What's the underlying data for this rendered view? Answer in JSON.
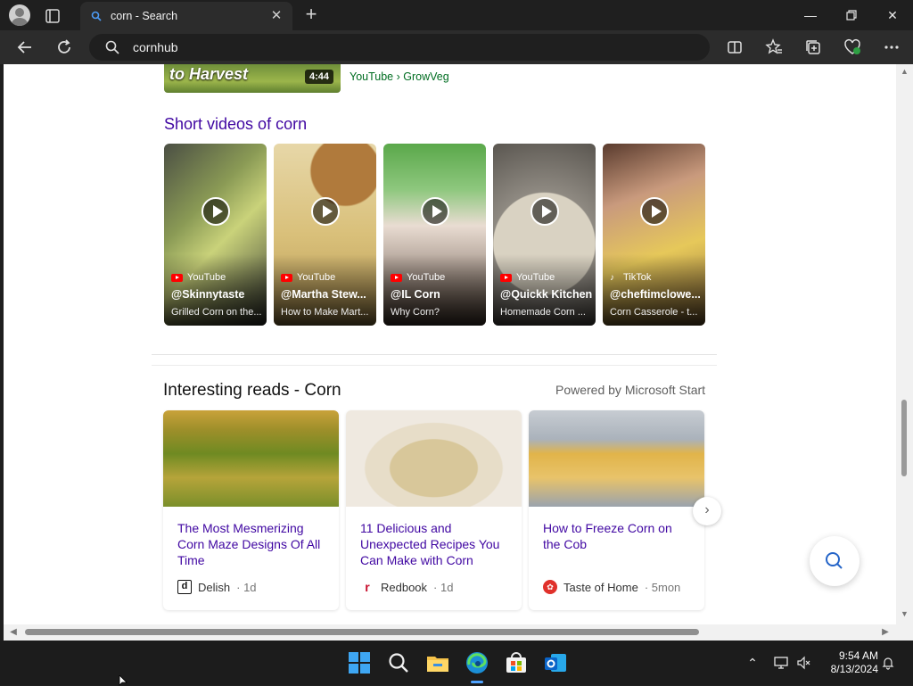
{
  "browser": {
    "tab_title": "corn - Search",
    "address": "cornhub"
  },
  "page": {
    "top_video": {
      "caption": "to Harvest",
      "duration": "4:44",
      "source": "YouTube › GrowVeg"
    },
    "short_videos": {
      "title": "Short videos of corn",
      "items": [
        {
          "source": "YouTube",
          "handle": "@Skinnytaste",
          "desc": "Grilled Corn on the..."
        },
        {
          "source": "YouTube",
          "handle": "@Martha Stew...",
          "desc": "How to Make Mart..."
        },
        {
          "source": "YouTube",
          "handle": "@IL Corn",
          "desc": "Why Corn?"
        },
        {
          "source": "YouTube",
          "handle": "@Quickk Kitchen",
          "desc": "Homemade Corn ..."
        },
        {
          "source": "TikTok",
          "handle": "@cheftimclowe...",
          "desc": "Corn Casserole - t..."
        }
      ]
    },
    "reads": {
      "title": "Interesting reads - Corn",
      "powered_by": "Powered by Microsoft Start",
      "items": [
        {
          "title": "The Most Mesmerizing Corn Maze Designs Of All Time",
          "publisher": "Delish",
          "age": "· 1d"
        },
        {
          "title": "11 Delicious and Unexpected Recipes You Can Make with Corn",
          "publisher": "Redbook",
          "age": "· 1d"
        },
        {
          "title": "How to Freeze Corn on the Cob",
          "publisher": "Taste of Home",
          "age": "· 5mon"
        }
      ]
    }
  },
  "taskbar": {
    "time": "9:54 AM",
    "date": "8/13/2024"
  },
  "colors": {
    "link_purple": "#4007a2",
    "source_green": "#006d21",
    "edge_accent": "#4fa3ff"
  }
}
